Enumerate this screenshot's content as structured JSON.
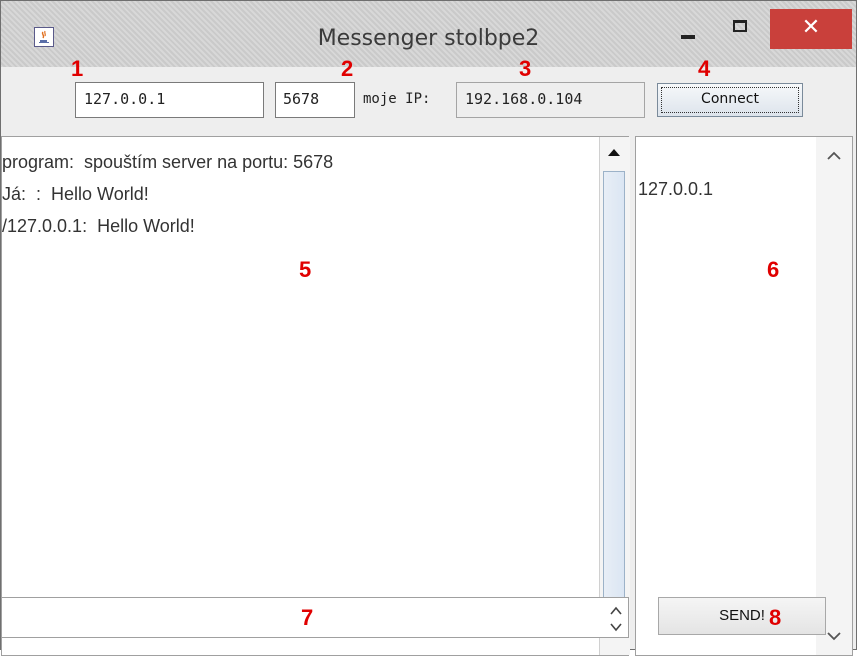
{
  "window": {
    "title": "Messenger stolbpe2",
    "close_glyph": "✕",
    "icon": "java-coffee-icon"
  },
  "toolbar": {
    "ip_value": "127.0.0.1",
    "port_value": "5678",
    "my_ip_label": "moje IP:",
    "my_ip_value": "192.168.0.104",
    "connect_label": "Connect"
  },
  "chat": {
    "lines": [
      "program:  spouštím server na portu: 5678",
      "Já:  :  Hello World!",
      "/127.0.0.1:  Hello World!"
    ]
  },
  "users": {
    "items": [
      "127.0.0.1"
    ]
  },
  "message": {
    "value": "",
    "send_label": "SEND!"
  },
  "annotations": {
    "n1": "1",
    "n2": "2",
    "n3": "3",
    "n4": "4",
    "n5": "5",
    "n6": "6",
    "n7": "7",
    "n8": "8"
  },
  "colors": {
    "annotation": "#e00000",
    "close_button": "#c9403b",
    "titlebar": "#d0d0d0"
  }
}
